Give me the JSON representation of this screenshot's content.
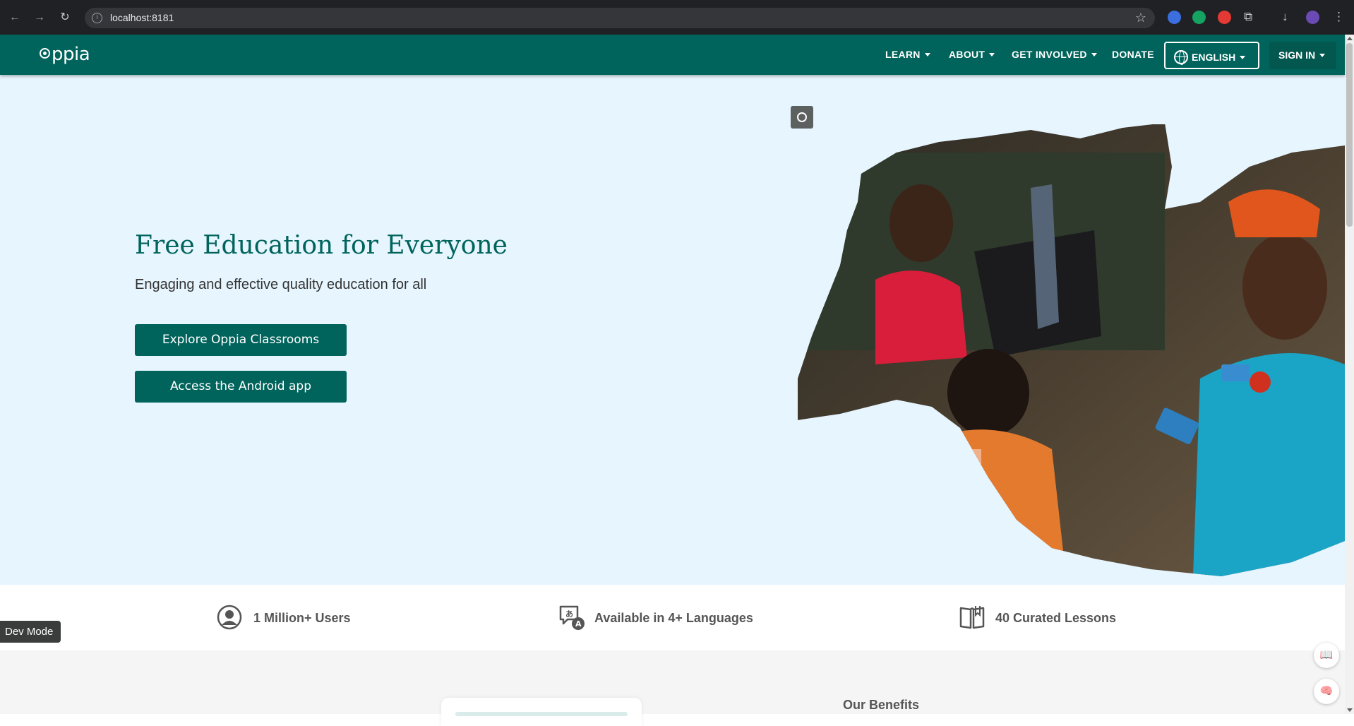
{
  "browser": {
    "url": "localhost:8181",
    "back_icon": "←",
    "forward_icon": "→",
    "reload_icon": "↻",
    "bookmark_icon": "☆",
    "info_icon": "i",
    "extensions_icon": "puzzle-icon",
    "download_icon": "↓",
    "menu_icon": "⋮"
  },
  "nav": {
    "brand": "ppia",
    "items": [
      "LEARN",
      "ABOUT",
      "GET INVOLVED",
      "DONATE"
    ],
    "language": "ENGLISH",
    "sign_in": "SIGN IN"
  },
  "hero": {
    "title": "Free Education for Everyone",
    "subtitle": "Engaging and effective quality education for all",
    "button_classrooms": "Explore Oppia Classrooms",
    "button_android": "Access the Android app"
  },
  "stats": [
    {
      "label": "1 Million+ Users",
      "icon": "user-circle-icon"
    },
    {
      "label": "Available in 4+ Languages",
      "icon": "translate-icon"
    },
    {
      "label": "40 Curated Lessons",
      "icon": "open-book-icon"
    }
  ],
  "lower": {
    "benefits_heading": "Our Benefits"
  },
  "dev_mode": "Dev Mode",
  "floating": {
    "book_icon": "📖",
    "brain_icon": "🧠"
  },
  "colors": {
    "primary": "#00645c",
    "hero_bg": "#e6f5fe",
    "lower_bg": "#f5f5f5"
  }
}
